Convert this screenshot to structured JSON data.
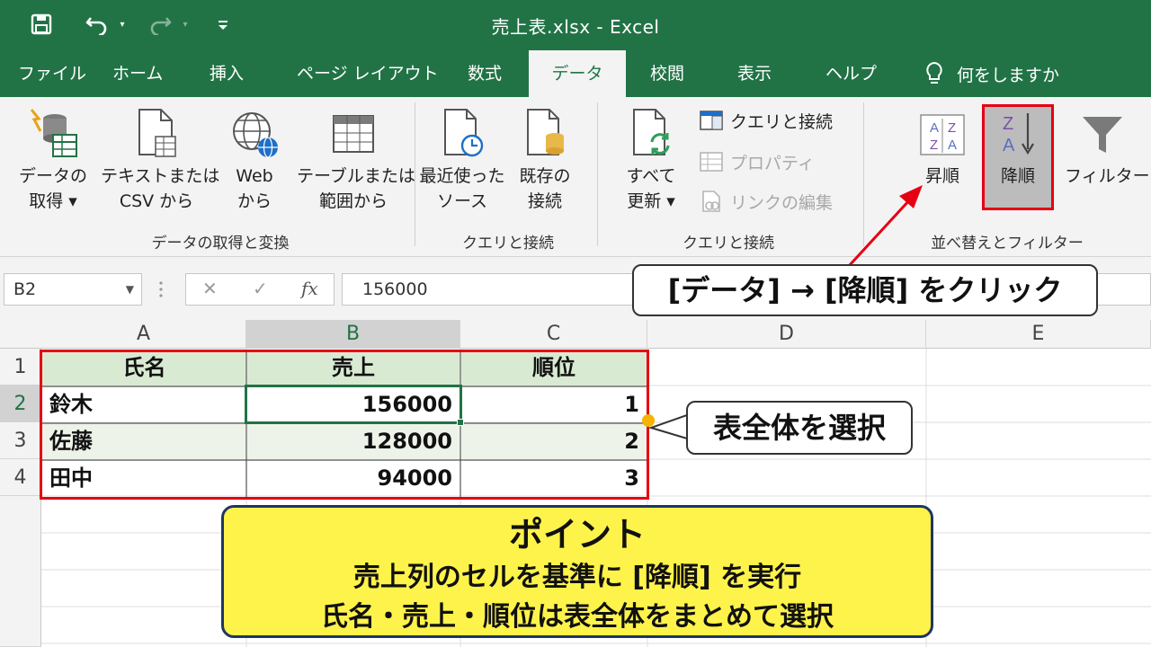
{
  "window": {
    "title": "売上表.xlsx  -  Excel"
  },
  "tabs": [
    {
      "label": "ファイル"
    },
    {
      "label": "ホーム"
    },
    {
      "label": "挿入"
    },
    {
      "label": "ページ レイアウト"
    },
    {
      "label": "数式"
    },
    {
      "label": "データ",
      "active": true
    },
    {
      "label": "校閲"
    },
    {
      "label": "表示"
    },
    {
      "label": "ヘルプ"
    }
  ],
  "tell_me": "何をしますか",
  "ribbon": {
    "get_data": {
      "line1": "データの",
      "line2": "取得 ▾"
    },
    "text_csv": {
      "line1": "テキストまたは",
      "line2": "CSV から"
    },
    "web": {
      "line1": "Web",
      "line2": "から"
    },
    "table_range": {
      "line1": "テーブルまたは",
      "line2": "範囲から"
    },
    "recent_sources": {
      "line1": "最近使った",
      "line2": "ソース"
    },
    "existing_conn": {
      "line1": "既存の",
      "line2": "接続"
    },
    "refresh_all": {
      "line1": "すべて",
      "line2": "更新 ▾"
    },
    "queries_conn": "クエリと接続",
    "properties": "プロパティ",
    "edit_links": "リンクの編集",
    "sort_asc": "昇順",
    "sort_desc": "降順",
    "filter": "フィルター",
    "groups": {
      "get_transform": "データの取得と変換",
      "queries1": "クエリと接続",
      "queries2": "クエリと接続",
      "sort_filter": "並べ替えとフィルター"
    }
  },
  "formula_bar": {
    "name_box": "B2",
    "value": "156000"
  },
  "columns": [
    "A",
    "B",
    "C",
    "D",
    "E"
  ],
  "rows": [
    "1",
    "2",
    "3",
    "4"
  ],
  "table": {
    "headers": [
      "氏名",
      "売上",
      "順位"
    ],
    "data": [
      {
        "name": "鈴木",
        "sales": "156000",
        "rank": "1"
      },
      {
        "name": "佐藤",
        "sales": "128000",
        "rank": "2"
      },
      {
        "name": "田中",
        "sales": "94000",
        "rank": "3"
      }
    ]
  },
  "callouts": {
    "click_instruction": "[データ] → [降順] をクリック",
    "select_table": "表全体を選択"
  },
  "point_box": {
    "title": "ポイント",
    "line1": "売上列のセルを基準に [降順] を実行",
    "line2": "氏名・売上・順位は表全体をまとめて選択"
  },
  "colors": {
    "excel_green": "#217346",
    "highlight_red": "#e60012",
    "point_yellow": "#fef34a",
    "point_border": "#1f3660"
  }
}
